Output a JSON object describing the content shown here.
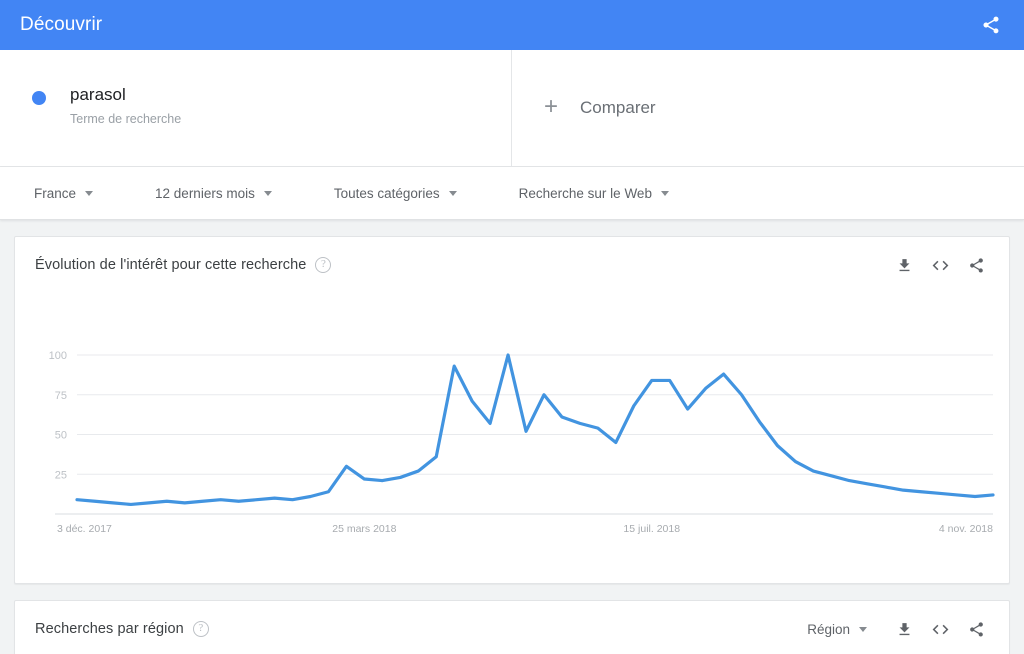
{
  "topbar": {
    "title": "Découvrir",
    "share_icon": "share-icon"
  },
  "terms": {
    "items": [
      {
        "name": "parasol",
        "subtitle": "Terme de recherche",
        "color": "#4285f4"
      }
    ],
    "compare": {
      "label": "Comparer",
      "plus": "+"
    }
  },
  "filters": [
    {
      "label": "France",
      "icon": "chevron-down-icon"
    },
    {
      "label": "12 derniers mois",
      "icon": "chevron-down-icon"
    },
    {
      "label": "Toutes catégories",
      "icon": "chevron-down-icon"
    },
    {
      "label": "Recherche sur le Web",
      "icon": "chevron-down-icon"
    }
  ],
  "interest_card": {
    "title": "Évolution de l'intérêt pour cette recherche",
    "help": "?",
    "tools": [
      {
        "name": "download-icon",
        "label": "Télécharger"
      },
      {
        "name": "embed-icon",
        "label": "Intégrer"
      },
      {
        "name": "share-icon",
        "label": "Partager"
      }
    ]
  },
  "region_card": {
    "title": "Recherches par région",
    "help": "?",
    "select_label": "Région",
    "tools": [
      {
        "name": "download-icon",
        "label": "Télécharger"
      },
      {
        "name": "embed-icon",
        "label": "Intégrer"
      },
      {
        "name": "share-icon",
        "label": "Partager"
      }
    ]
  },
  "chart_data": {
    "type": "line",
    "title": "Évolution de l'intérêt pour cette recherche",
    "xlabel": "",
    "ylabel": "",
    "ylim": [
      0,
      100
    ],
    "yticks": [
      25,
      50,
      75,
      100
    ],
    "ytick_labels": [
      "25",
      "50",
      "75",
      "100"
    ],
    "xtick_labels": [
      "3 déc. 2017",
      "25 mars 2018",
      "15 juil. 2018",
      "4 nov. 2018"
    ],
    "xtick_indices": [
      0,
      16,
      32,
      48
    ],
    "grid": true,
    "legend": false,
    "line_color": "#4294e0",
    "series": [
      {
        "name": "parasol",
        "color": "#4294e0",
        "x": [
          "3 déc. 2017",
          "10 déc. 2017",
          "17 déc. 2017",
          "24 déc. 2017",
          "31 déc. 2017",
          "7 janv. 2018",
          "14 janv. 2018",
          "21 janv. 2018",
          "28 janv. 2018",
          "4 févr. 2018",
          "11 févr. 2018",
          "18 févr. 2018",
          "25 févr. 2018",
          "4 mars 2018",
          "11 mars 2018",
          "18 mars 2018",
          "25 mars 2018",
          "1 avr. 2018",
          "8 avr. 2018",
          "15 avr. 2018",
          "22 avr. 2018",
          "29 avr. 2018",
          "6 mai 2018",
          "13 mai 2018",
          "20 mai 2018",
          "27 mai 2018",
          "3 juin 2018",
          "10 juin 2018",
          "17 juin 2018",
          "24 juin 2018",
          "1 juil. 2018",
          "8 juil. 2018",
          "15 juil. 2018",
          "22 juil. 2018",
          "29 juil. 2018",
          "5 août 2018",
          "12 août 2018",
          "19 août 2018",
          "26 août 2018",
          "2 sept. 2018",
          "9 sept. 2018",
          "16 sept. 2018",
          "23 sept. 2018",
          "30 sept. 2018",
          "7 oct. 2018",
          "14 oct. 2018",
          "21 oct. 2018",
          "28 oct. 2018",
          "4 nov. 2018",
          "11 nov. 2018",
          "18 nov. 2018",
          "25 nov. 2018"
        ],
        "values": [
          9,
          8,
          7,
          6,
          7,
          8,
          7,
          8,
          9,
          8,
          9,
          10,
          9,
          11,
          14,
          30,
          22,
          21,
          23,
          27,
          36,
          93,
          71,
          57,
          100,
          52,
          75,
          61,
          57,
          54,
          45,
          68,
          84,
          84,
          66,
          79,
          88,
          75,
          58,
          43,
          33,
          27,
          24,
          21,
          19,
          17,
          15,
          14,
          13,
          12,
          11,
          12
        ]
      }
    ]
  }
}
